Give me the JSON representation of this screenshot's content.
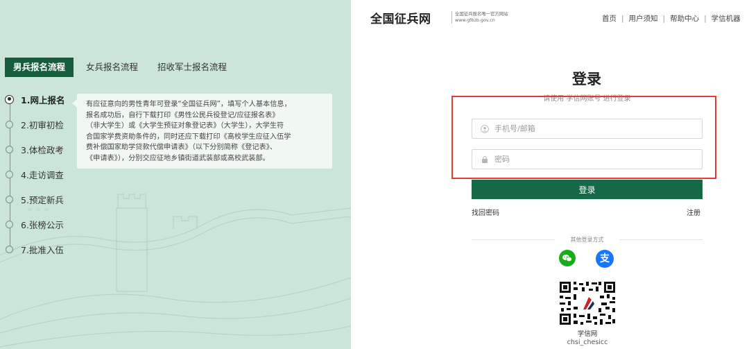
{
  "tabs": [
    {
      "label": "男兵报名流程",
      "active": true
    },
    {
      "label": "女兵报名流程",
      "active": false
    },
    {
      "label": "招收军士报名流程",
      "active": false
    }
  ],
  "steps": [
    {
      "label": "1.网上报名",
      "active": true
    },
    {
      "label": "2.初审初检",
      "active": false
    },
    {
      "label": "3.体检政考",
      "active": false
    },
    {
      "label": "4.走访调查",
      "active": false
    },
    {
      "label": "5.预定新兵",
      "active": false
    },
    {
      "label": "6.张榜公示",
      "active": false
    },
    {
      "label": "7.批准入伍",
      "active": false
    }
  ],
  "step_description": [
    "有应征意向的男性青年可登录“全国征兵网”，填写个人基本信息，",
    "报名成功后，自行下载打印《男性公民兵役登记/应征报名表》",
    "（非大学生）或《大学生预征对象登记表》（大学生），大学生符",
    "合国家学费资助条件的，同时还应下载打印《高校学生应征入伍学",
    "费补偿国家助学贷款代偿申请表》（以下分别简称《登记表》、",
    "《申请表》），分别交应征地乡镇街道武装部或高校武装部。"
  ],
  "header": {
    "logo_title": "全国征兵网",
    "logo_subtitle_1": "全国征兵报名唯一官方网站",
    "logo_subtitle_2": "www.gfbzb.gov.cn",
    "nav": [
      "首页",
      "用户须知",
      "帮助中心",
      "学信机器"
    ]
  },
  "login": {
    "title": "登录",
    "subtitle": "请使用 学信网账号 进行登录",
    "username_placeholder": "手机号/邮箱",
    "password_placeholder": "密码",
    "submit_label": "登录",
    "forgot_label": "找回密码",
    "register_label": "注册",
    "other_methods_label": "其他登录方式",
    "alipay_glyph": "支"
  },
  "qr": {
    "name": "学信网",
    "id": "chsi_chesicc"
  },
  "colors": {
    "left_bg": "#cbe6d9",
    "brand_green": "#156947",
    "highlight_red": "#e53935",
    "wechat_green": "#1aad19",
    "alipay_blue": "#1677ff"
  }
}
